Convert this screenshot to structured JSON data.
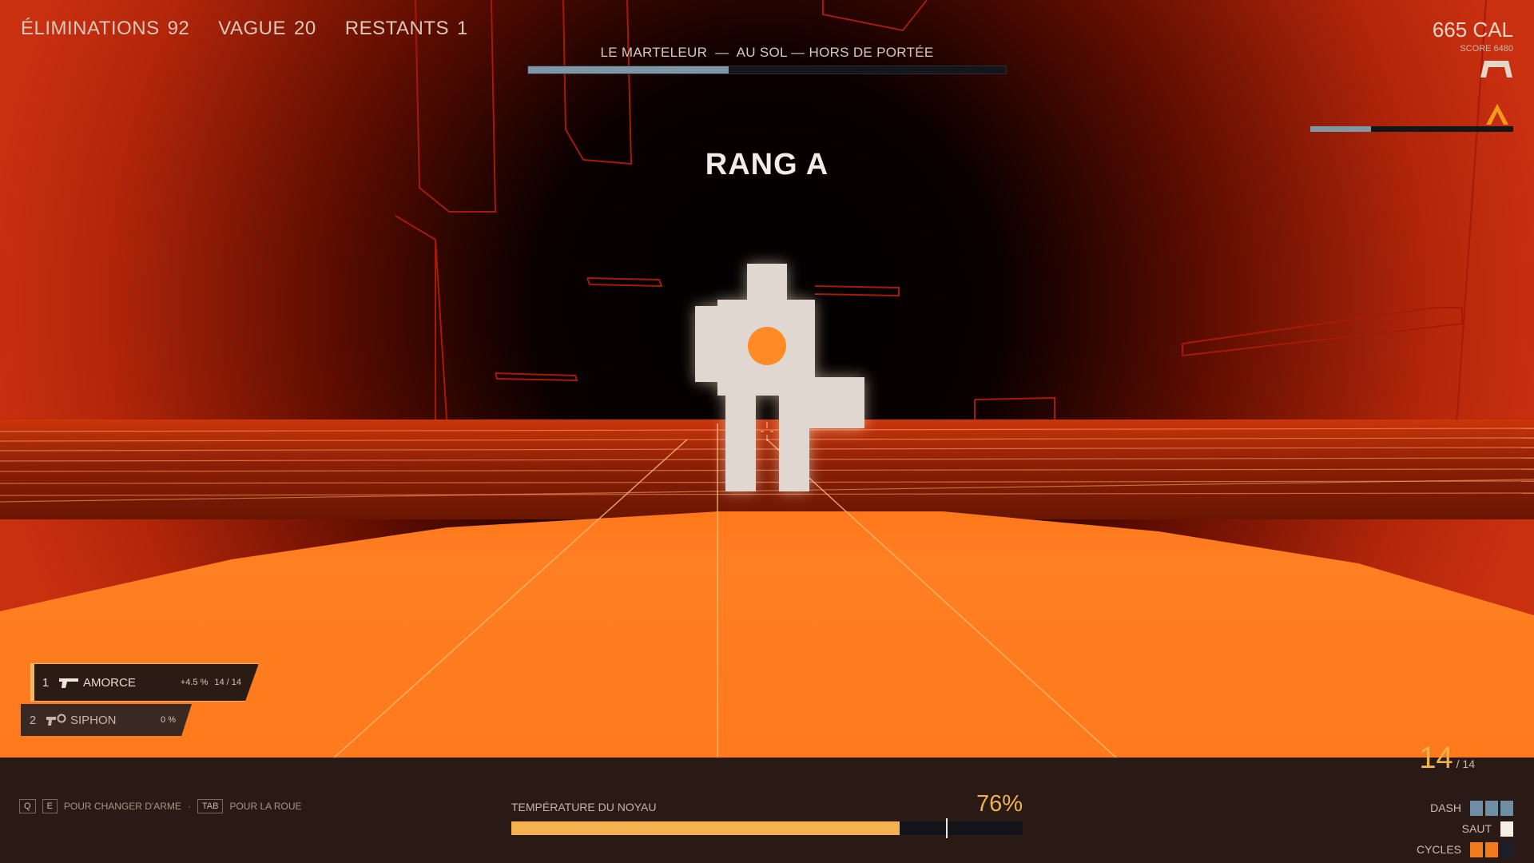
{
  "hud": {
    "stats": [
      {
        "label": "ÉLIMINATIONS",
        "value": "92"
      },
      {
        "label": "VAGUE",
        "value": "20"
      },
      {
        "label": "RESTANTS",
        "value": "1"
      }
    ],
    "boss": {
      "label": "LE MARTELEUR  —  AU SOL — HORS DE PORTÉE",
      "health_fraction": 0.42
    },
    "rank": "RANG A",
    "calories": "665 CAL",
    "score": "SCORE 6480",
    "charge_fraction": 0.3,
    "icons": [
      "dash-arch-icon",
      "rank-chevron-icon"
    ]
  },
  "weapons": [
    {
      "slot": "1",
      "name": "AMORCE",
      "bonus": "+4.5 %",
      "ammo": "14 / 14",
      "icon": "pistol-icon",
      "selected": true
    },
    {
      "slot": "2",
      "name": "SIPHON",
      "bonus": "0 %",
      "ammo": "",
      "icon": "siphon-icon",
      "selected": false
    }
  ],
  "controls": {
    "key_q": "Q",
    "key_e": "E",
    "switch_text": "POUR CHANGER D'ARME",
    "separator": "·",
    "key_tab": "TAB",
    "wheel_text": "POUR LA ROUE"
  },
  "core": {
    "label": "TEMPÉRATURE DU NOYAU",
    "percent_text": "76%",
    "fill_fraction": 0.76,
    "marker_fraction": 0.85
  },
  "ammo": {
    "current": "14",
    "max": "/ 14"
  },
  "movement": {
    "dash": {
      "label": "DASH",
      "total": 3,
      "filled": 3
    },
    "jump": {
      "label": "SAUT",
      "total": 1,
      "filled": 1
    },
    "cycles": {
      "label": "CYCLES",
      "total": 3,
      "filled": 2
    }
  },
  "colors": {
    "accent": "#f0b24f",
    "boss_bar": "#7f96a6",
    "dash_pip": "#6f8fa7",
    "cycle_pip": "#f07a1c",
    "sky_red": "#c32a0a",
    "floor_orange": "#ff7c1f",
    "enemy": "#e0d8d0"
  }
}
